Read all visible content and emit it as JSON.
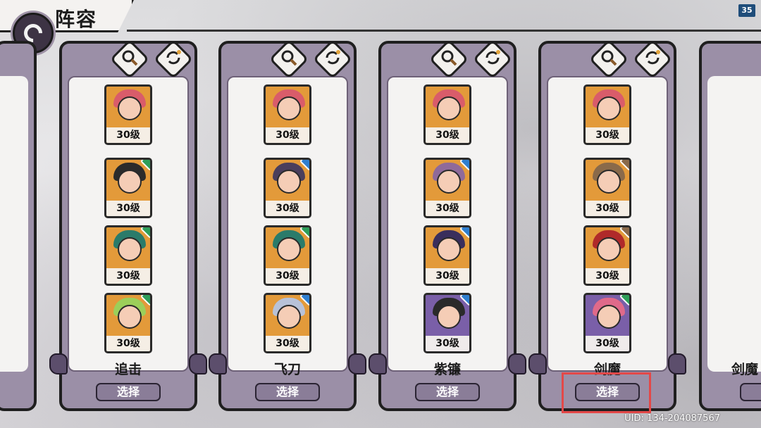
{
  "header": {
    "title": "阵容",
    "fps": "35"
  },
  "uid": "UID: 134-204087567",
  "teams": [
    {
      "name": "追击",
      "select_label": "选择",
      "heroes": [
        {
          "level": "30级",
          "hair": "#d95c6a",
          "bg": "#e39a3a",
          "elem": ""
        },
        {
          "level": "30级",
          "hair": "#2b2b2b",
          "bg": "#e39a3a",
          "elem": "#2e9e5a"
        },
        {
          "level": "30级",
          "hair": "#2a7b6a",
          "bg": "#e39a3a",
          "elem": "#2e9e5a"
        },
        {
          "level": "30级",
          "hair": "#9ccf5a",
          "bg": "#e39a3a",
          "elem": "#2e9e5a"
        }
      ]
    },
    {
      "name": "飞刀",
      "select_label": "选择",
      "heroes": [
        {
          "level": "30级",
          "hair": "#d95c6a",
          "bg": "#e39a3a",
          "elem": ""
        },
        {
          "level": "30级",
          "hair": "#4a3e5c",
          "bg": "#e39a3a",
          "elem": "#2f7fd0"
        },
        {
          "level": "30级",
          "hair": "#2a7b6a",
          "bg": "#e39a3a",
          "elem": "#2e9e5a"
        },
        {
          "level": "30级",
          "hair": "#b8c2d8",
          "bg": "#e39a3a",
          "elem": "#2f7fd0"
        }
      ]
    },
    {
      "name": "紫镰",
      "select_label": "选择",
      "heroes": [
        {
          "level": "30级",
          "hair": "#d95c6a",
          "bg": "#e39a3a",
          "elem": ""
        },
        {
          "level": "30级",
          "hair": "#8f6a9a",
          "bg": "#e39a3a",
          "elem": "#2f7fd0"
        },
        {
          "level": "30级",
          "hair": "#3a2e5c",
          "bg": "#e39a3a",
          "elem": "#2f7fd0"
        },
        {
          "level": "30级",
          "hair": "#2a2a2a",
          "bg": "#7a5fa8",
          "elem": "#2f7fd0"
        }
      ]
    },
    {
      "name": "剑魔",
      "select_label": "选择",
      "heroes": [
        {
          "level": "30级",
          "hair": "#d95c6a",
          "bg": "#e39a3a",
          "elem": ""
        },
        {
          "level": "30级",
          "hair": "#8a6a4a",
          "bg": "#e39a3a",
          "elem": "#8a6a4a"
        },
        {
          "level": "30级",
          "hair": "#b02a2a",
          "bg": "#e39a3a",
          "elem": "#8a6a4a"
        },
        {
          "level": "30级",
          "hair": "#e06a8a",
          "bg": "#7a5fa8",
          "elem": "#2e9e5a"
        }
      ]
    }
  ],
  "partial_right_name": "剑魔"
}
